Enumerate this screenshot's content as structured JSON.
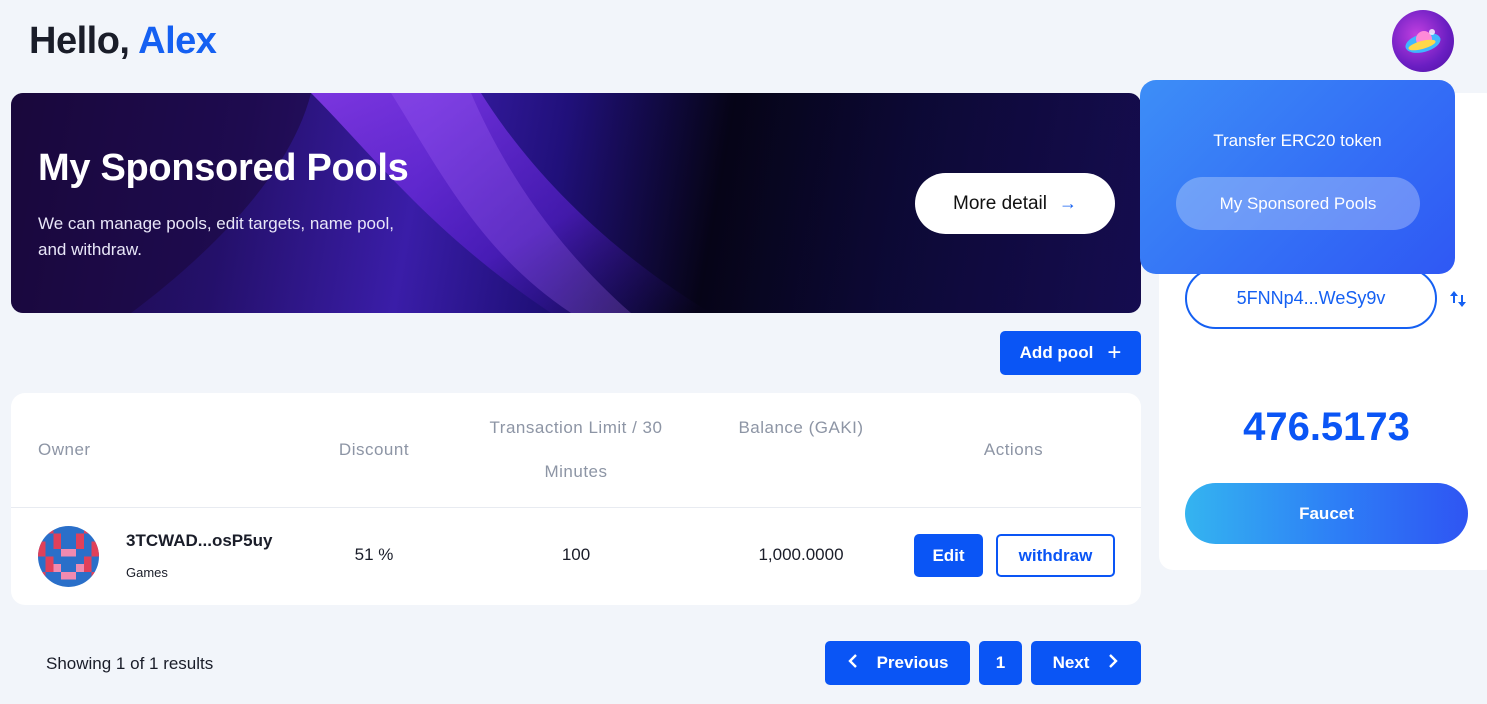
{
  "header": {
    "greeting_prefix": "Hello,",
    "user_name": "Alex"
  },
  "banner": {
    "title": "My Sponsored Pools",
    "description": "We can manage pools, edit targets, name pool, and withdraw.",
    "more_label": "More detail",
    "more_icon": "arrow-right-icon"
  },
  "toolbar": {
    "add_pool_label": "Add pool",
    "add_pool_icon": "plus-icon"
  },
  "table": {
    "columns": {
      "owner": "Owner",
      "discount": "Discount",
      "limit": "Transaction Limit / 30 Minutes",
      "balance": "Balance (GAKI)",
      "actions": "Actions"
    },
    "rows": [
      {
        "address": "3TCWAD...osP5uy",
        "category": "Games",
        "discount": "51 %",
        "limit": "100",
        "balance": "1,000.0000",
        "edit_label": "Edit",
        "withdraw_label": "withdraw"
      }
    ]
  },
  "pagination": {
    "summary": "Showing 1 of 1 results",
    "prev_label": "Previous",
    "current_page": "1",
    "next_label": "Next"
  },
  "wallet": {
    "address": "5FNNp4...WeSy9v",
    "balance": "476.5173",
    "faucet_label": "Faucet"
  },
  "dropdown": {
    "title": "Transfer ERC20 token",
    "item_label": "My Sponsored Pools"
  },
  "colors": {
    "accent": "#0a55f5",
    "background": "#f2f5fa"
  }
}
